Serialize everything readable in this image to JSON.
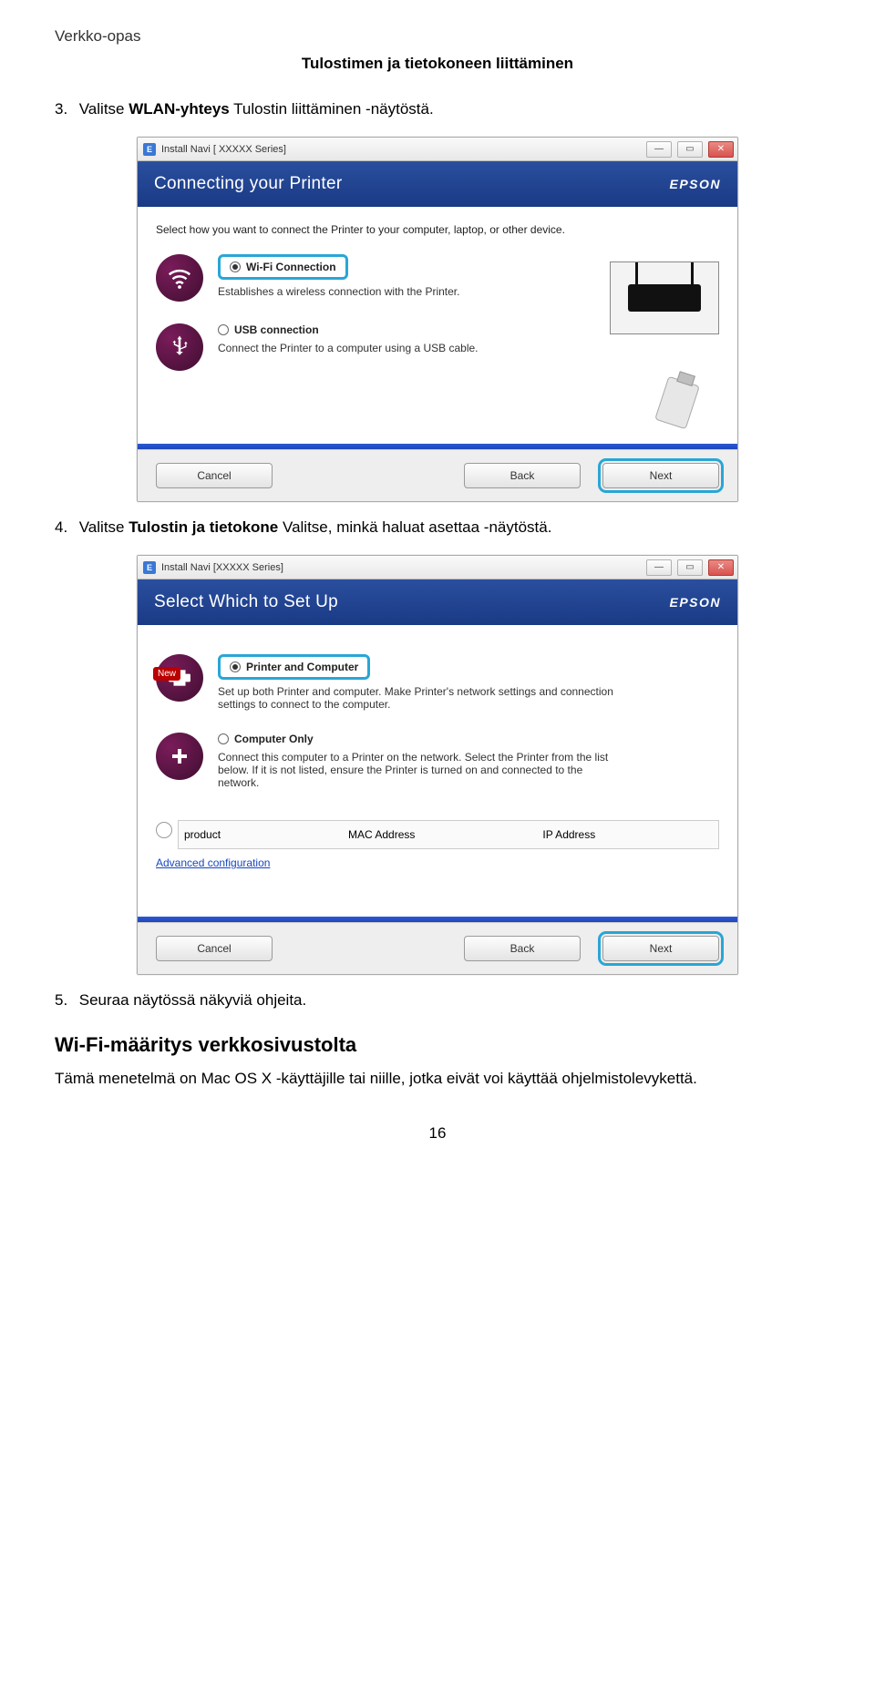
{
  "doc": {
    "header_left": "Verkko-opas",
    "header_center": "Tulostimen ja tietokoneen liittäminen",
    "page_number": "16"
  },
  "steps": {
    "s3_num": "3.",
    "s3_a": "Valitse ",
    "s3_b": "WLAN-yhteys",
    "s3_c": " Tulostin liittäminen -näytöstä.",
    "s4_num": "4.",
    "s4_a": "Valitse ",
    "s4_b": "Tulostin ja tietokone",
    "s4_c": " Valitse, minkä haluat asettaa -näytöstä.",
    "s5_num": "5.",
    "s5_text": "Seuraa näytössä näkyviä ohjeita."
  },
  "wiz1": {
    "title": "Install Navi [    XXXXX    Series]",
    "banner_title": "Connecting your Printer",
    "brand": "EPSON",
    "intro": "Select how you want to connect the Printer to your computer, laptop, or other device.",
    "opt1_label": "Wi-Fi Connection",
    "opt1_desc": "Establishes a wireless connection with the Printer.",
    "opt2_label": "USB connection",
    "opt2_desc": "Connect the Printer to a computer using a USB cable.",
    "btn_cancel": "Cancel",
    "btn_back": "Back",
    "btn_next": "Next"
  },
  "wiz2": {
    "title": "Install Navi [XXXXX       Series]",
    "banner_title": "Select Which to Set Up",
    "brand": "EPSON",
    "opt1_label": "Printer and Computer",
    "opt1_desc": "Set up both Printer and computer. Make Printer's network settings and connection settings to connect to the computer.",
    "opt1_badge": "New",
    "opt2_label": "Computer Only",
    "opt2_desc": "Connect this computer to a Printer on the network. Select the Printer from the list below. If it is not listed, ensure the Printer is turned on and connected to the network.",
    "th_product": "product",
    "th_mac": "MAC Address",
    "th_ip": "IP Address",
    "adv_link": "Advanced configuration",
    "btn_cancel": "Cancel",
    "btn_back": "Back",
    "btn_next": "Next"
  },
  "section": {
    "heading": "Wi-Fi-määritys verkkosivustolta",
    "para": "Tämä menetelmä on Mac OS X -käyttäjille tai niille, jotka eivät voi käyttää ohjelmistolevykettä."
  }
}
